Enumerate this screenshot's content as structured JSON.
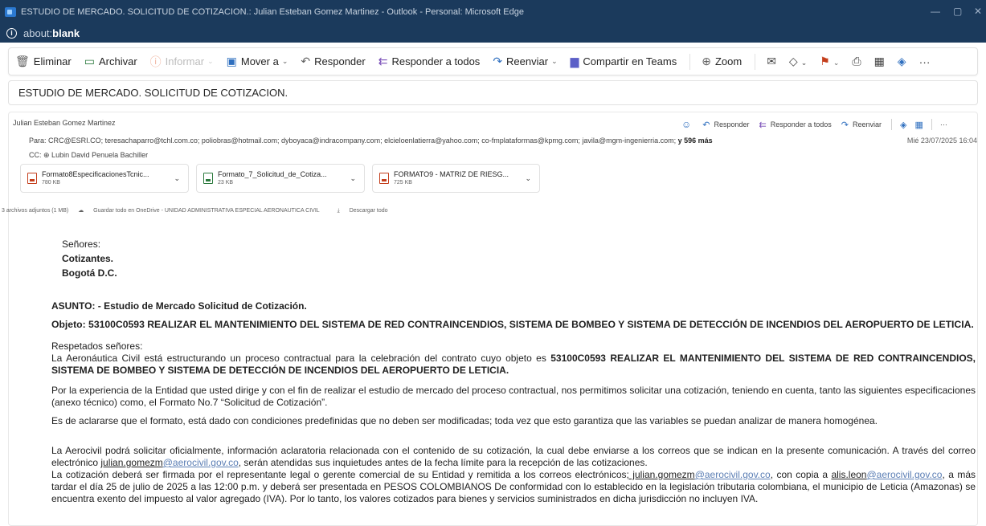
{
  "window": {
    "title": "ESTUDIO DE MERCADO. SOLICITUD DE COTIZACION.: Julian Esteban Gomez Martinez - Outlook - Personal: Microsoft Edge",
    "address_protocol": "about:",
    "address_path": "blank",
    "controls": {
      "minimize": "—",
      "maximize": "▢",
      "close": "✕"
    }
  },
  "toolbar": {
    "delete": "Eliminar",
    "archive": "Archivar",
    "report": "Informar",
    "move": "Mover a",
    "reply": "Responder",
    "reply_all": "Responder a todos",
    "forward": "Reenviar",
    "share_teams": "Compartir en Teams",
    "zoom": "Zoom",
    "more": "···"
  },
  "subject": "ESTUDIO DE MERCADO. SOLICITUD DE COTIZACION.",
  "message": {
    "sender": "Julian Esteban Gomez Martinez",
    "to_label": "Para:",
    "to_list": "CRC@ESRI.CO;  teresachaparro@tchl.com.co;  poliobras@hotmail.com;  dyboyaca@indracompany.com;  elcieloenlatierra@yahoo.com;  co-fmplataformas@kpmg.com;  javila@mgm-ingenierria.com;",
    "to_more": "y 596 más",
    "cc_label": "CC:",
    "cc_value": "⊕ Lubin David Penuela Bachiller",
    "date": "Mié 23/07/2025 16:04",
    "actions": {
      "reply": "Responder",
      "reply_all": "Responder a todos",
      "forward": "Reenviar",
      "more": "···"
    }
  },
  "attachments": [
    {
      "name": "Formato8EspecificacionesTcnic...",
      "size": "780 KB",
      "type": "pdf"
    },
    {
      "name": "Formato_7_Solicitud_de_Cotiza...",
      "size": "23 KB",
      "type": "docx"
    },
    {
      "name": "FORMATO9 - MATRIZ DE RIESG...",
      "size": "725 KB",
      "type": "pdf"
    }
  ],
  "attachments_summary": {
    "count": "3 archivos adjuntos (1 MB)",
    "save": "Guardar todo en OneDrive - UNIDAD ADMINISTRATIVA ESPECIAL AERONAUTICA CIVIL",
    "download": "Descargar todo"
  },
  "body": {
    "salutation": "Señores:",
    "recipient_1": "Cotizantes.",
    "recipient_2": "Bogotá D.C.",
    "subject_line": "ASUNTO: - Estudio de Mercado Solicitud de Cotización.",
    "object_line": "Objeto: 53100C0593 REALIZAR EL MANTENIMIENTO DEL SISTEMA DE RED CONTRAINCENDIOS, SISTEMA DE BOMBEO Y SISTEMA DE DETECCIÓN DE INCENDIOS DEL AEROPUERTO DE LETICIA.",
    "greeting": "Respetados señores:",
    "p1_text": "La Aeronáutica Civil está estructurando un proceso contractual para la celebración del contrato cuyo objeto es ",
    "p1_bold": "53100C0593 REALIZAR EL MANTENIMIENTO DEL SISTEMA DE RED CONTRAINCENDIOS, SISTEMA DE BOMBEO Y SISTEMA DE DETECCIÓN DE INCENDIOS DEL AEROPUERTO DE LETICIA.",
    "p2": "Por la experiencia de la Entidad que usted dirige y con el fin de realizar el estudio de mercado del proceso contractual, nos permitimos solicitar una cotización, teniendo en cuenta, tanto las siguientes especificaciones (anexo técnico) como, el Formato No.7 “Solicitud de Cotización”.",
    "p3": "Es de aclararse que el formato, está dado con condiciones predefinidas que no deben ser modificadas; toda vez que esto garantiza que las variables se puedan analizar de manera homogénea.",
    "p4_a": "La Aerocivil podrá solicitar oficialmente, información aclaratoria relacionada con el contenido de su cotización, la cual debe enviarse a los correos que se indican en la presente comunicación. A través del correo electrónico ",
    "p4_user": "julian.gomezm",
    "p4_domain": "@aerocivil.gov.co",
    "p4_b": ", serán atendidas sus inquietudes antes de la fecha límite para la recepción de las cotizaciones.",
    "p5_a": "La cotización deberá ser firmada por el representante legal o gerente comercial de su Entidad y remitida a los correos electrónicos",
    "p5_user1": "; julian.gomezm",
    "p5_domain1": "@aerocivil.gov.co",
    "p5_b": ", con copia a ",
    "p5_user2": "alis.leon",
    "p5_domain2": "@aerocivil.gov.co",
    "p5_c": ", a más tardar el día 25 de julio de 2025 a las 12:00 p.m. y deberá ser presentada en PESOS COLOMBIANOS De conformidad con lo establecido en la legislación tributaria colombiana, el municipio de Leticia (Amazonas) se encuentra exento del impuesto al valor agregado (IVA). Por lo tanto, los valores cotizados para bienes y servicios suministrados en dicha jurisdicción no incluyen IVA."
  }
}
